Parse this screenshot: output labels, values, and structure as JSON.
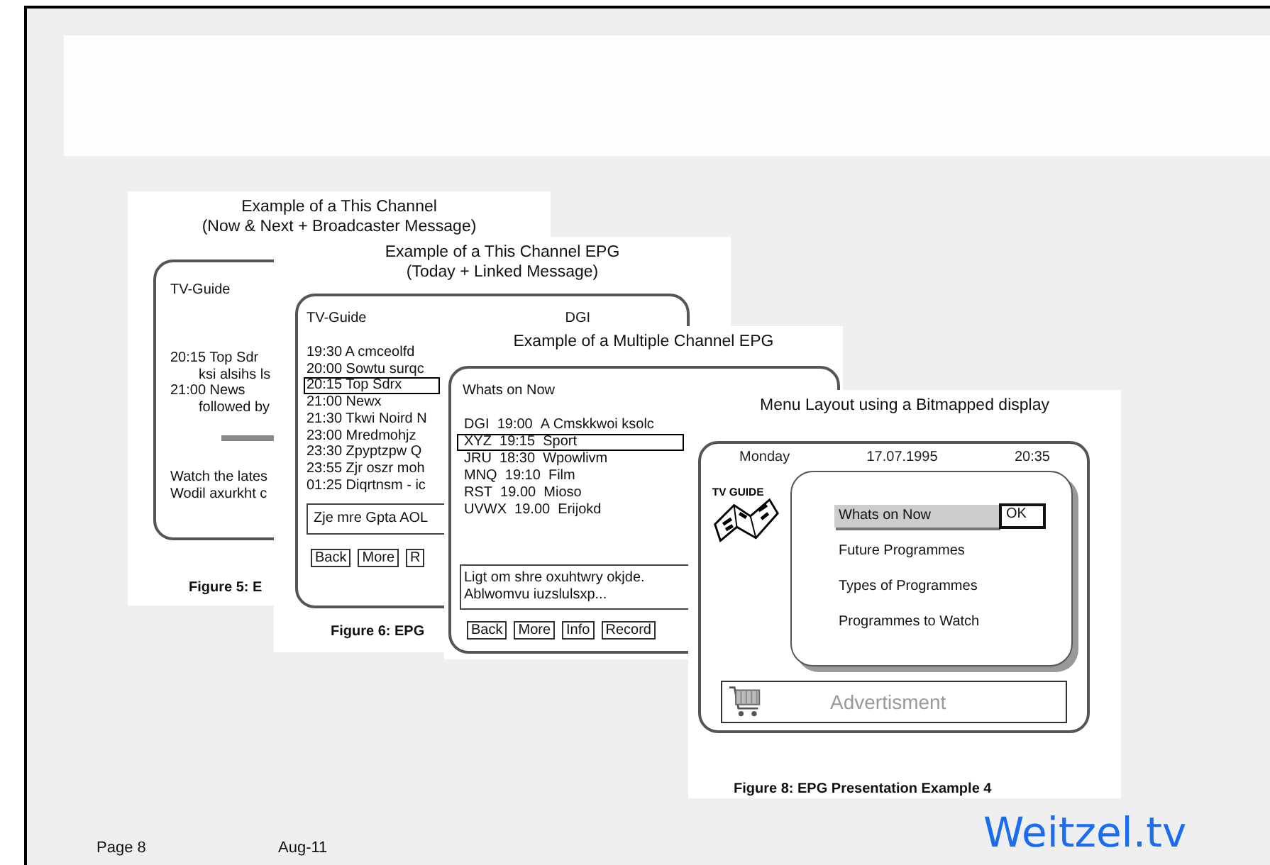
{
  "figures": [
    {
      "kind": "now_next",
      "title_lines": [
        "Example of a This Channel",
        "(Now & Next + Broadcaster Message)"
      ],
      "header": "TV-Guide",
      "lines": [
        {
          "text": "20:15 Top Sdr",
          "children": [
            {
              "text": "ksi alsihs ls"
            }
          ]
        },
        {
          "text": "21:00 News",
          "children": [
            {
              "text": "followed by"
            }
          ]
        }
      ],
      "message_lines": [
        "Watch the lates",
        "Wodil axurkht c"
      ],
      "caption": "Figure 5: E"
    },
    {
      "kind": "today",
      "title_lines": [
        "Example of a This Channel EPG",
        "(Today + Linked Message)"
      ],
      "header": "TV-Guide",
      "channel": "DGI",
      "rows": [
        {
          "text": "19:30 A cmceolfd",
          "selected": false
        },
        {
          "text": "20:00 Sowtu surqc",
          "selected": false
        },
        {
          "text": "20:15 Top Sdrx",
          "selected": true
        },
        {
          "text": "21:00 Newx",
          "selected": false
        },
        {
          "text": "21:30 Tkwi Noird N",
          "selected": false
        },
        {
          "text": "23:00 Mredmohjz",
          "selected": false
        },
        {
          "text": "23:30 Zpyptzpw Q",
          "selected": false
        },
        {
          "text": "23:55 Zjr oszr moh",
          "selected": false
        },
        {
          "text": "01:25 Diqrtnsm - ic",
          "selected": false
        }
      ],
      "message": "Zje mre Gpta AOL",
      "buttons": [
        "Back",
        "More",
        "R"
      ],
      "caption": "Figure 6: EPG"
    },
    {
      "kind": "multi",
      "title_lines": [
        "Example of a Multiple Channel EPG"
      ],
      "header": "Whats on Now",
      "rows": [
        {
          "channel": "DGI",
          "time": "19:00",
          "programme": "A Cmskkwoi ksolc",
          "selected": false
        },
        {
          "channel": "XYZ",
          "time": "19:15",
          "programme": "Sport",
          "selected": true
        },
        {
          "channel": "JRU",
          "time": "18:30",
          "programme": "Wpowlivm",
          "selected": false
        },
        {
          "channel": "MNQ",
          "time": "19:10",
          "programme": "Film",
          "selected": false
        },
        {
          "channel": "RST",
          "time": "19.00",
          "programme": "Mioso",
          "selected": false
        },
        {
          "channel": "UVWX",
          "time": "19.00",
          "programme": "Erijokd",
          "selected": false
        }
      ],
      "message_lines": [
        "Ligt om shre oxuhtwry okjde.",
        "Ablwomvu iuzslulsxp..."
      ],
      "buttons": [
        "Back",
        "More",
        "Info",
        "Record"
      ]
    },
    {
      "kind": "menu",
      "title_lines": [
        "Menu Layout using a Bitmapped display"
      ],
      "day": "Monday",
      "date": "17.07.1995",
      "time": "20:35",
      "logo_text": "TV GUIDE",
      "items": [
        {
          "label": "Whats on Now",
          "selected": true
        },
        {
          "label": "Future Programmes",
          "selected": false
        },
        {
          "label": "Types of Programmes",
          "selected": false
        },
        {
          "label": "Programmes to Watch",
          "selected": false
        }
      ],
      "ok": "OK",
      "advert": "Advertisment",
      "caption": "Figure 8: EPG Presentation Example 4"
    }
  ],
  "footer": {
    "page": "Page 8",
    "date": "Aug-11",
    "brand": "Weitzel.tv"
  }
}
